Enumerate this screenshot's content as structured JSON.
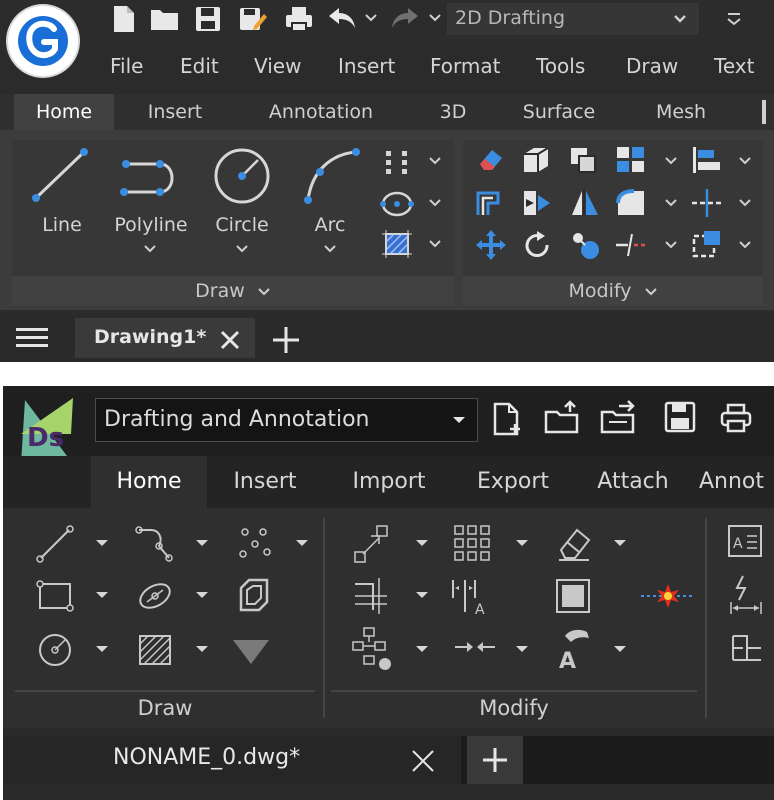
{
  "panel_a": {
    "workspace": "2D Drafting",
    "menu": [
      "File",
      "Edit",
      "View",
      "Insert",
      "Format",
      "Tools",
      "Draw",
      "Text"
    ],
    "tabs": [
      "Home",
      "Insert",
      "Annotation",
      "3D",
      "Surface",
      "Mesh"
    ],
    "active_tab": "Home",
    "draw_tools": [
      "Line",
      "Polyline",
      "Circle",
      "Arc"
    ],
    "draw_panel_label": "Draw",
    "modify_panel_label": "Modify",
    "document_tab": "Drawing1*",
    "colors": {
      "accent_blue": "#3a8de0",
      "background": "#2b2b2b",
      "ribbon": "#3c3c3c"
    }
  },
  "panel_b": {
    "workspace": "Drafting and Annotation",
    "tabs": [
      "Home",
      "Insert",
      "Import",
      "Export",
      "Attach",
      "Annot"
    ],
    "active_tab": "Home",
    "draw_panel_label": "Draw",
    "modify_panel_label": "Modify",
    "document_tab": "NONAME_0.dwg*",
    "colors": {
      "background": "#2a2a2a",
      "icon_gray": "#c8c8c8",
      "red_star": "#e0301e"
    }
  }
}
